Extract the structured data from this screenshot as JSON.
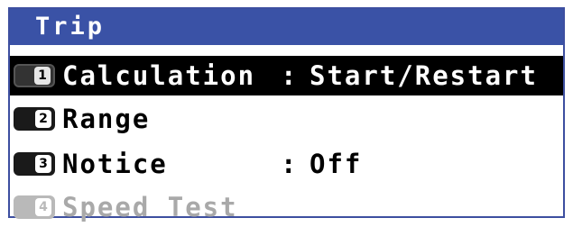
{
  "window": {
    "title": "Trip"
  },
  "menu": {
    "items": [
      {
        "key": "1",
        "label": "Calculation",
        "separator": ":",
        "value": "Start/Restart",
        "state": "selected"
      },
      {
        "key": "2",
        "label": "Range",
        "separator": "",
        "value": "",
        "state": "normal"
      },
      {
        "key": "3",
        "label": "Notice",
        "separator": ":",
        "value": "Off",
        "state": "normal"
      },
      {
        "key": "4",
        "label": "Speed Test",
        "separator": "",
        "value": "",
        "state": "disabled"
      }
    ]
  },
  "colors": {
    "title_bar": "#3a52a6",
    "selected_row": "#000000",
    "disabled_text": "#a9a9a9"
  }
}
